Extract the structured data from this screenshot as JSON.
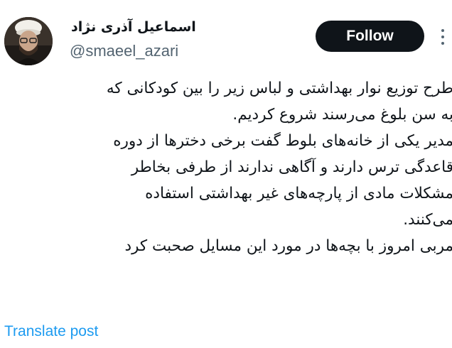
{
  "author": {
    "display_name": "اسماعیل آذری نژاد",
    "handle": "@smaeel_azari"
  },
  "follow_button": {
    "label": "Follow"
  },
  "post": {
    "lines": [
      "طرح توزیع نوار بهداشتی و لباس زیر را بین کودکانی که",
      "به سن بلوغ می‌رسند شروع کردیم.",
      "مدیر یکی از خانه‌های بلوط گفت برخی دخترها از دوره",
      "قاعدگی ترس دارند و آگاهی ندارند از طرفی بخاطر",
      "مشکلات مادی از پارچه‌های غیر بهداشتی استفاده",
      "می‌کنند.",
      "مربی امروز با بچه‌ها در مورد این مسایل صحبت کرد"
    ]
  },
  "translate_link": {
    "label": "Translate post"
  },
  "icons": {
    "avatar": "profile-photo",
    "more": "more-vertical-icon"
  }
}
